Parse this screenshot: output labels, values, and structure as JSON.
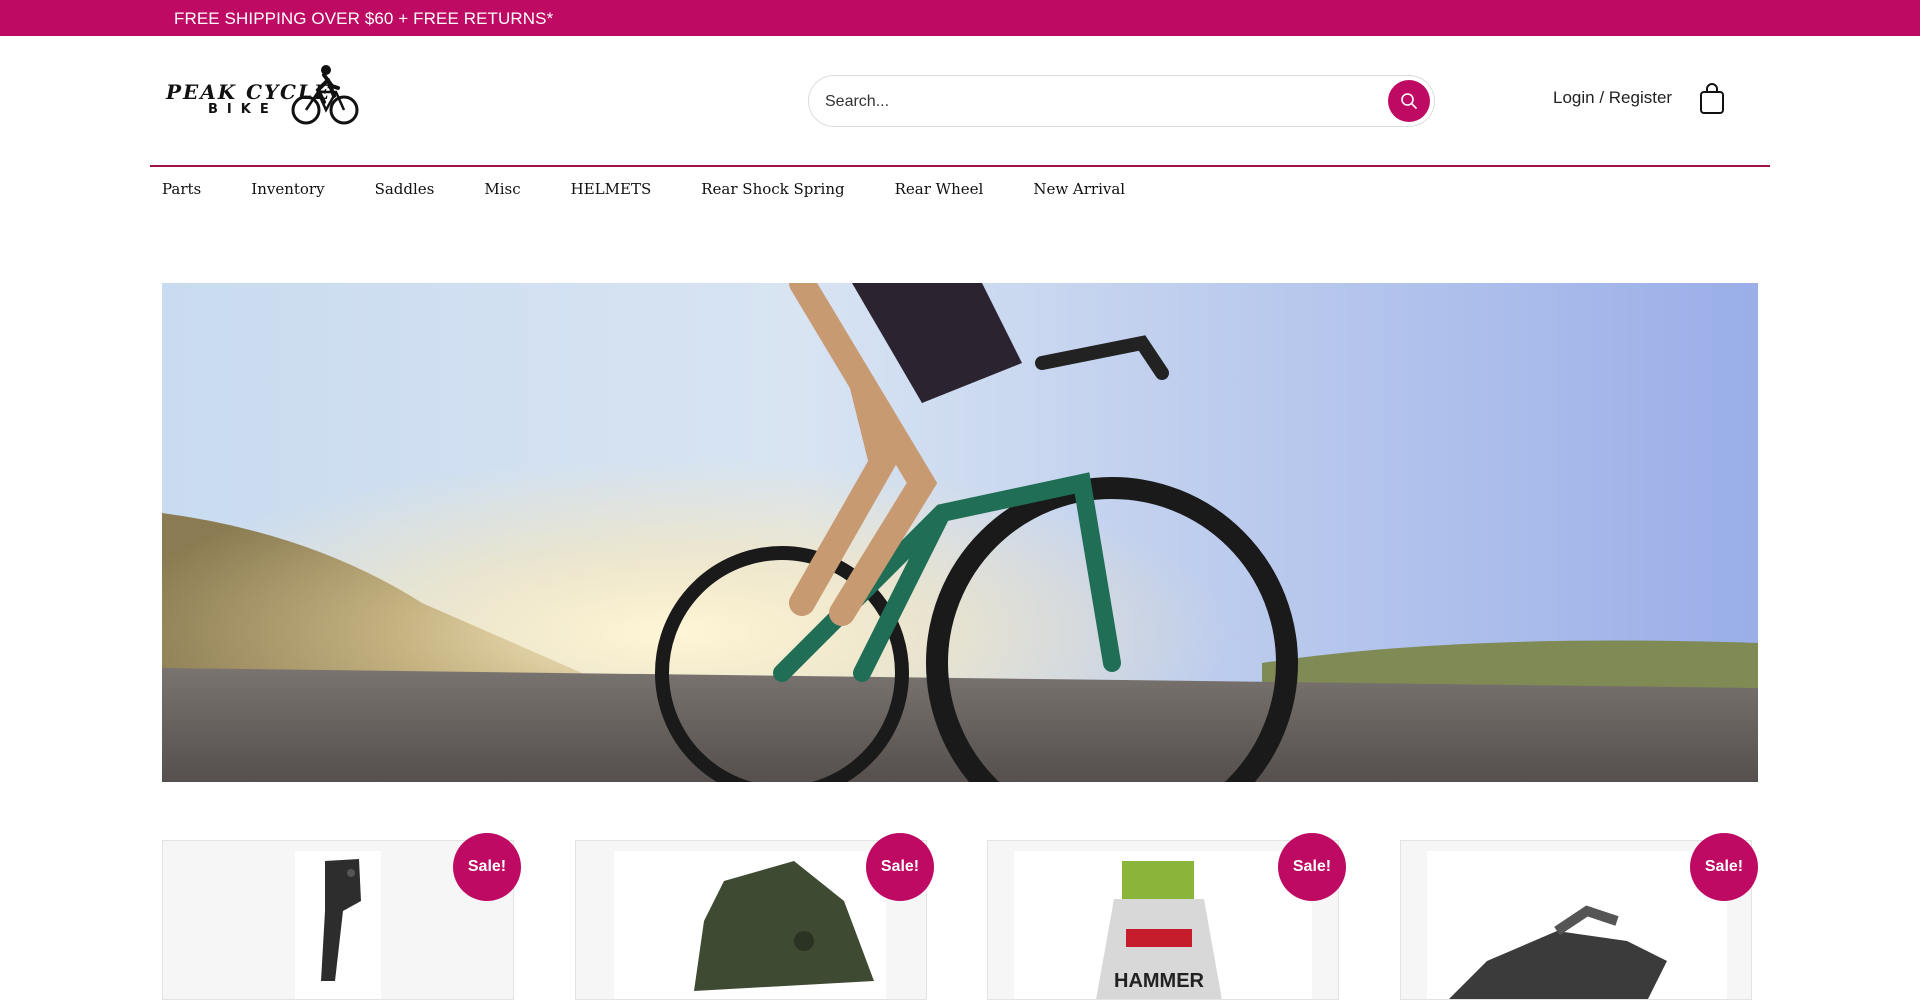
{
  "announcement": {
    "text": "FREE SHIPPING OVER $60 + FREE RETURNS*"
  },
  "brand": {
    "line1": "PEAK CYCLE",
    "line2": "BIKE"
  },
  "search": {
    "placeholder": "Search..."
  },
  "account": {
    "login_label": "Login / Register"
  },
  "nav": {
    "items": [
      "Parts",
      "Inventory",
      "Saddles",
      "Misc",
      "HELMETS",
      "Rear Shock Spring",
      "Rear Wheel",
      "New Arrival"
    ]
  },
  "products": [
    {
      "badge": "Sale!"
    },
    {
      "badge": "Sale!"
    },
    {
      "badge": "Sale!"
    },
    {
      "badge": "Sale!"
    }
  ],
  "colors": {
    "accent": "#bf0a63",
    "nav_rule": "#a0104f"
  },
  "icons": {
    "search": "search-icon",
    "cart": "shopping-bag-icon"
  }
}
